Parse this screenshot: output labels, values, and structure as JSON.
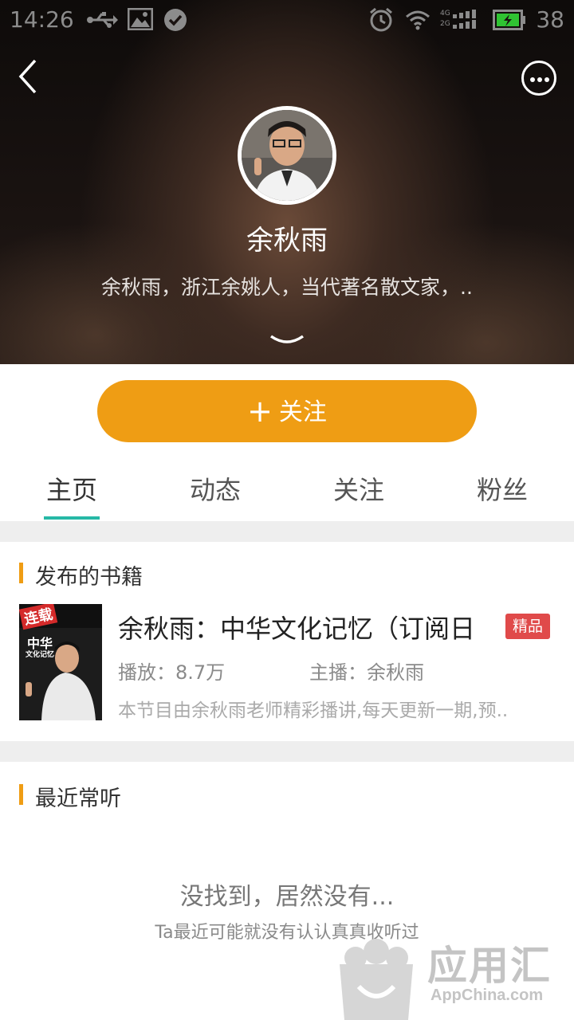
{
  "status_bar": {
    "time": "14:26",
    "network_labels": [
      "4G",
      "2G"
    ],
    "battery": "38"
  },
  "profile": {
    "name": "余秋雨",
    "description": "余秋雨，浙江余姚人，当代著名散文家，.."
  },
  "follow_button": {
    "label": "关注"
  },
  "tabs": [
    {
      "label": "主页",
      "active": true
    },
    {
      "label": "动态",
      "active": false
    },
    {
      "label": "关注",
      "active": false
    },
    {
      "label": "粉丝",
      "active": false
    }
  ],
  "published_books": {
    "title": "发布的书籍",
    "items": [
      {
        "cover_text": "连载",
        "cover_subtitle": "中华",
        "cover_caption": "文化记忆",
        "title": "余秋雨：中华文化记忆（订阅日",
        "badge": "精品",
        "plays": "播放：8.7万",
        "host": "主播：余秋雨",
        "description": "本节目由余秋雨老师精彩播讲,每天更新一期,预.."
      }
    ]
  },
  "recent_listens": {
    "title": "最近常听",
    "empty_title": "没找到，居然没有...",
    "empty_subtitle": "Ta最近可能就没有认认真真收听过"
  },
  "watermark": {
    "text": "应用汇",
    "sub": "AppChina.com"
  },
  "colors": {
    "accent": "#ef9d14",
    "tab_indicator": "#26b8a6",
    "badge": "#e04a4a"
  }
}
